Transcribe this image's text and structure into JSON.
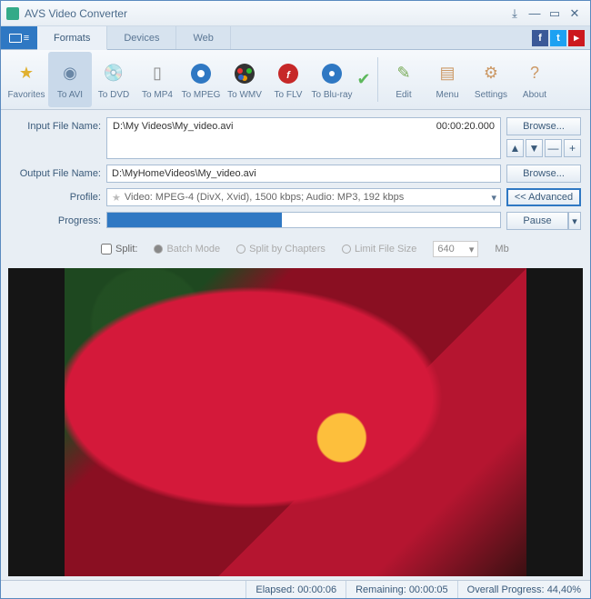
{
  "title": "AVS Video Converter",
  "tabs": {
    "formats": "Formats",
    "devices": "Devices",
    "web": "Web"
  },
  "toolbar": {
    "favorites": "Favorites",
    "toavi": "To AVI",
    "todvd": "To DVD",
    "tomp4": "To MP4",
    "tompeg": "To MPEG",
    "towmv": "To WMV",
    "toflv": "To FLV",
    "tobluray": "To Blu-ray",
    "edit": "Edit",
    "menu": "Menu",
    "settings": "Settings",
    "about": "About"
  },
  "labels": {
    "input": "Input File Name:",
    "output": "Output File Name:",
    "profile": "Profile:",
    "progress": "Progress:"
  },
  "input": {
    "path": "D:\\My Videos\\My_video.avi",
    "duration": "00:00:20.000"
  },
  "output": {
    "path": "D:\\MyHomeVideos\\My_video.avi"
  },
  "profile": {
    "text": "Video: MPEG-4 (DivX, Xvid), 1500 kbps; Audio: MP3, 192 kbps"
  },
  "buttons": {
    "browse": "Browse...",
    "advanced": "<< Advanced",
    "pause": "Pause"
  },
  "split": {
    "label": "Split:",
    "batch": "Batch Mode",
    "chapters": "Split by Chapters",
    "limit": "Limit File Size",
    "size": "640",
    "unit": "Mb"
  },
  "progress": {
    "percent": 44.4
  },
  "status": {
    "elapsed_label": "Elapsed:",
    "elapsed": "00:00:06",
    "remaining_label": "Remaining:",
    "remaining": "00:00:05",
    "overall_label": "Overall Progress:",
    "overall": "44,40%"
  }
}
